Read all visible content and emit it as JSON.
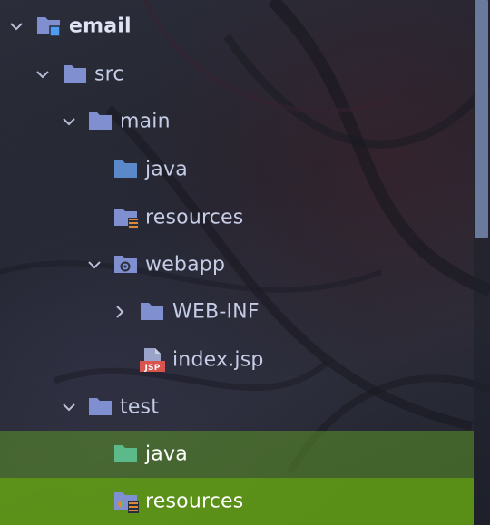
{
  "project_tree": {
    "items": [
      {
        "label": "email",
        "depth": 0,
        "expanded": true,
        "icon": "module-folder-icon"
      },
      {
        "label": "src",
        "depth": 1,
        "expanded": true,
        "icon": "folder-icon"
      },
      {
        "label": "main",
        "depth": 2,
        "expanded": true,
        "icon": "folder-icon"
      },
      {
        "label": "java",
        "depth": 3,
        "icon": "source-root-folder-icon"
      },
      {
        "label": "resources",
        "depth": 3,
        "icon": "resources-folder-icon"
      },
      {
        "label": "webapp",
        "depth": 3,
        "expanded": true,
        "icon": "web-folder-icon"
      },
      {
        "label": "WEB-INF",
        "depth": 4,
        "expanded": false,
        "icon": "folder-icon"
      },
      {
        "label": "index.jsp",
        "depth": 4,
        "icon": "jsp-file-icon",
        "badge": "JSP"
      },
      {
        "label": "test",
        "depth": 2,
        "expanded": true,
        "icon": "folder-icon"
      },
      {
        "label": "java",
        "depth": 3,
        "icon": "test-source-folder-icon"
      },
      {
        "label": "resources",
        "depth": 3,
        "icon": "test-resources-folder-icon"
      }
    ]
  },
  "colors": {
    "folder": "#7f8fcf",
    "source_folder": "#5b88c8",
    "test_folder": "#5cb98a",
    "selection_light": "#5c9628",
    "selection_strong": "#68aa12",
    "jsp_badge": "#d9534f"
  }
}
